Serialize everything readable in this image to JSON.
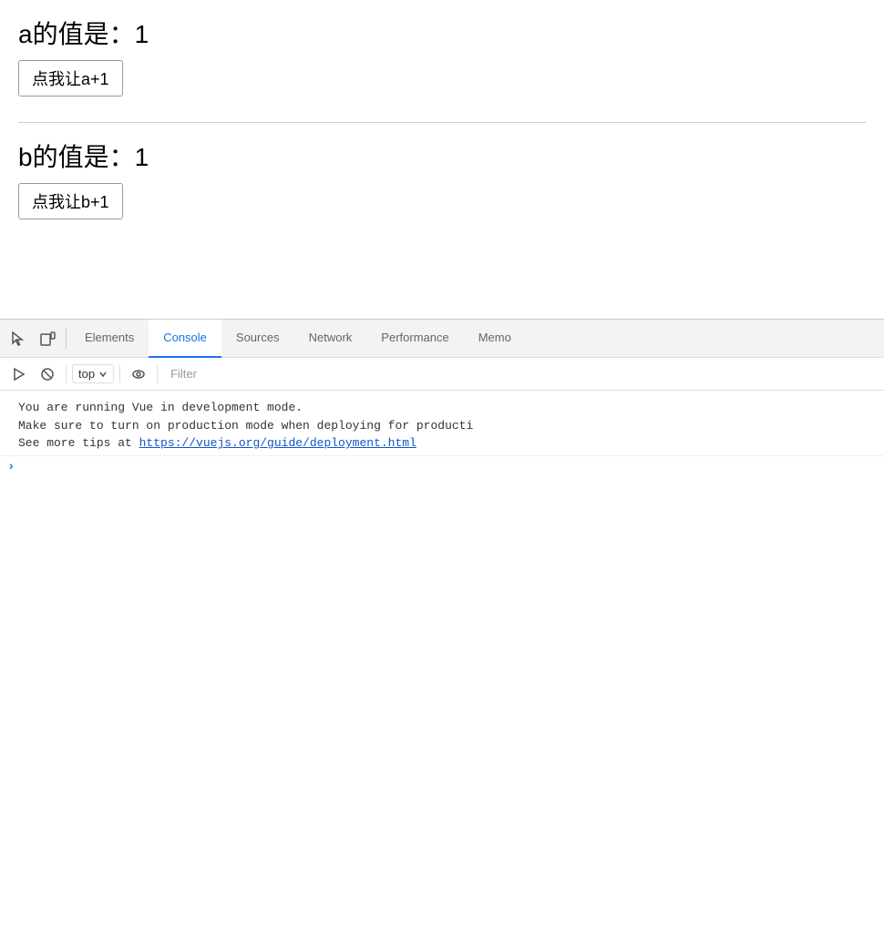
{
  "page": {
    "a_label": "a的值是：",
    "a_value": "1",
    "a_button": "点我让a+1",
    "b_label": "b的值是：",
    "b_value": "1",
    "b_button": "点我让b+1"
  },
  "devtools": {
    "tabs": [
      {
        "id": "elements",
        "label": "Elements",
        "active": false
      },
      {
        "id": "console",
        "label": "Console",
        "active": true
      },
      {
        "id": "sources",
        "label": "Sources",
        "active": false
      },
      {
        "id": "network",
        "label": "Network",
        "active": false
      },
      {
        "id": "performance",
        "label": "Performance",
        "active": false
      },
      {
        "id": "memory",
        "label": "Memo",
        "active": false
      }
    ],
    "toolbar": {
      "top_label": "top",
      "filter_placeholder": "Filter"
    },
    "console_messages": [
      {
        "line1": "You are running Vue in development mode.",
        "line2": "Make sure to turn on production mode when deploying for producti",
        "line3_prefix": "See more tips at ",
        "line3_link": "https://vuejs.org/guide/deployment.html"
      }
    ]
  }
}
